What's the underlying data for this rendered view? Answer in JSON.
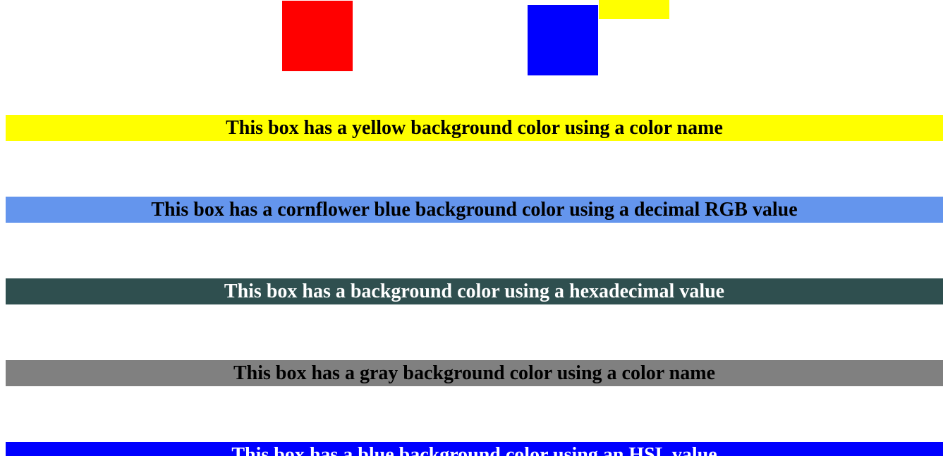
{
  "squares": [
    {
      "name": "red",
      "color": "#FF0000"
    },
    {
      "name": "blue",
      "color": "#0000FF"
    },
    {
      "name": "yellow",
      "color": "#FFFF00"
    }
  ],
  "boxes": [
    {
      "text": "This box has a yellow background color using a color name",
      "bg": "#FFFF00",
      "fg": "#000000"
    },
    {
      "text": "This box has a cornflower blue background color using a decimal RGB value",
      "bg": "#6495ED",
      "fg": "#000000"
    },
    {
      "text": "This box has a background color using a hexadecimal value",
      "bg": "#2F4F4F",
      "fg": "#FFFFFF"
    },
    {
      "text": "This box has a gray background color using a color name",
      "bg": "#808080",
      "fg": "#000000"
    },
    {
      "text": "This box has a blue background color using an HSL value",
      "bg": "#0000FF",
      "fg": "#FFFFFF"
    }
  ]
}
